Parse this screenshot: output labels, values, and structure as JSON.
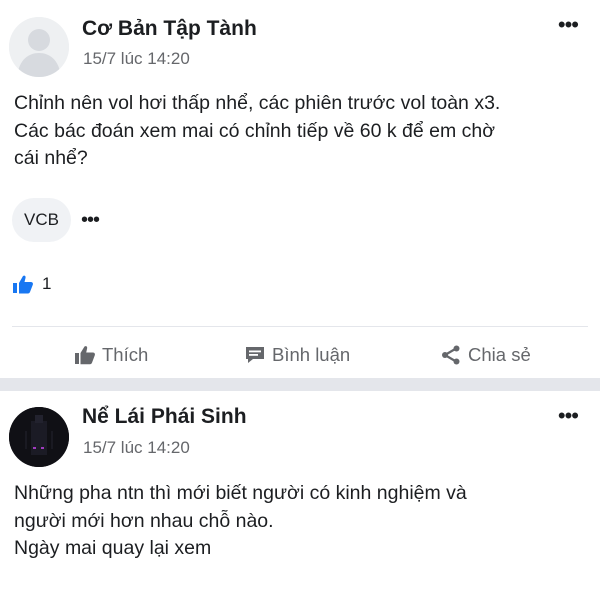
{
  "posts": [
    {
      "author": "Cơ Bản Tập Tành",
      "time": "15/7 lúc 14:20",
      "text_lines": [
        "Chỉnh nên vol hơi thấp nhể, các phiên trước vol toàn x3.",
        "Các bác đoán xem mai có chỉnh tiếp về 60 k để em chờ",
        "cái nhể?"
      ],
      "tag": "VCB",
      "reaction_count": "1",
      "actions": {
        "like": "Thích",
        "comment": "Bình luận",
        "share": "Chia sẻ"
      }
    },
    {
      "author": "Nể Lái Phái Sinh",
      "time": "15/7 lúc 14:20",
      "text_lines": [
        "Những pha ntn thì mới biết người có kinh nghiệm và",
        "người mới hơn nhau chỗ nào.",
        "Ngày mai quay lại xem"
      ]
    }
  ],
  "icons": {
    "more": "ellipsis-icon",
    "like": "thumbs-up-icon",
    "comment": "comment-icon",
    "share": "share-icon",
    "reaction": "like-reaction-icon"
  },
  "colors": {
    "accent": "#1877f2",
    "muted": "#65676b",
    "divider": "#e4e6eb"
  }
}
